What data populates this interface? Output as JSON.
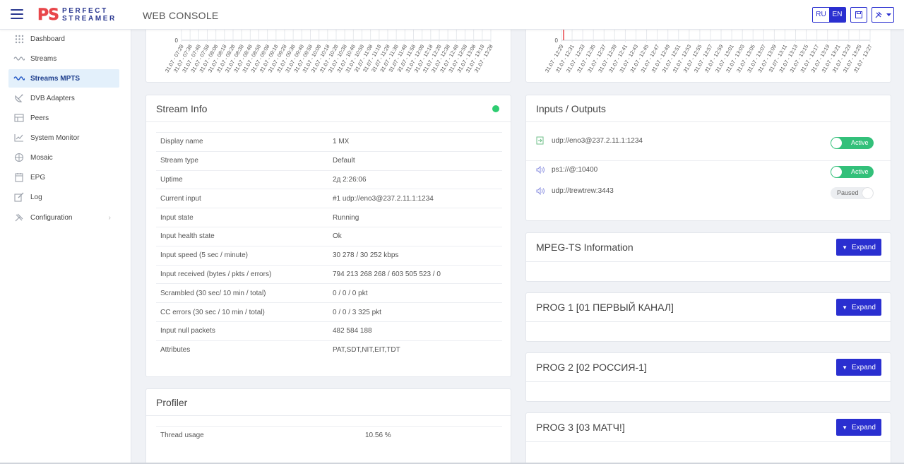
{
  "brand": {
    "ps": "PS",
    "line1": "PERFECT",
    "line2": "STREAMER"
  },
  "header": {
    "title": "WEB CONSOLE",
    "lang_ru": "RU",
    "lang_en": "EN"
  },
  "colors": {
    "accent": "#2a2fd0",
    "brand_red": "#e8464a",
    "brand_blue": "#2a3890",
    "active_green": "#33c07a",
    "chart_marker": "#e8464a"
  },
  "sidebar": {
    "items": [
      {
        "label": "Dashboard",
        "icon": "dashboard-grid-icon"
      },
      {
        "label": "Streams",
        "icon": "streams-wave-icon"
      },
      {
        "label": "Streams MPTS",
        "icon": "mpts-wave-icon"
      },
      {
        "label": "DVB Adapters",
        "icon": "satellite-dish-icon"
      },
      {
        "label": "Peers",
        "icon": "peers-icon"
      },
      {
        "label": "System Monitor",
        "icon": "chart-monitor-icon"
      },
      {
        "label": "Mosaic",
        "icon": "mosaic-icon"
      },
      {
        "label": "EPG",
        "icon": "epg-calendar-icon"
      },
      {
        "label": "Log",
        "icon": "log-edit-icon"
      },
      {
        "label": "Configuration",
        "icon": "tools-icon"
      }
    ]
  },
  "chart_left": {
    "y_zero": "0",
    "ticks": [
      "31.07 - 07:28",
      "31.07 - 07:38",
      "31.07 - 07:48",
      "31.07 - 07:58",
      "31.07 - 08:08",
      "31.07 - 08:18",
      "31.07 - 08:28",
      "31.07 - 08:38",
      "31.07 - 08:48",
      "31.07 - 08:58",
      "31.07 - 09:08",
      "31.07 - 09:18",
      "31.07 - 09:28",
      "31.07 - 09:38",
      "31.07 - 09:48",
      "31.07 - 09:58",
      "31.07 - 10:08",
      "31.07 - 10:18",
      "31.07 - 10:28",
      "31.07 - 10:38",
      "31.07 - 10:48",
      "31.07 - 10:58",
      "31.07 - 11:08",
      "31.07 - 11:18",
      "31.07 - 11:28",
      "31.07 - 11:38",
      "31.07 - 11:48",
      "31.07 - 11:58",
      "31.07 - 12:08",
      "31.07 - 12:18",
      "31.07 - 12:28",
      "31.07 - 12:38",
      "31.07 - 12:48",
      "31.07 - 12:58",
      "31.07 - 13:08",
      "31.07 - 13:18",
      "31.07 - 13:28"
    ]
  },
  "chart_right": {
    "y_zero": "0",
    "ticks": [
      "31.07 - 12:29",
      "31.07 - 12:31",
      "31.07 - 12:33",
      "31.07 - 12:35",
      "31.07 - 12:37",
      "31.07 - 12:39",
      "31.07 - 12:41",
      "31.07 - 12:43",
      "31.07 - 12:45",
      "31.07 - 12:47",
      "31.07 - 12:49",
      "31.07 - 12:51",
      "31.07 - 12:53",
      "31.07 - 12:55",
      "31.07 - 12:57",
      "31.07 - 12:59",
      "31.07 - 13:01",
      "31.07 - 13:03",
      "31.07 - 13:05",
      "31.07 - 13:07",
      "31.07 - 13:09",
      "31.07 - 13:11",
      "31.07 - 13:13",
      "31.07 - 13:15",
      "31.07 - 13:17",
      "31.07 - 13:19",
      "31.07 - 13:21",
      "31.07 - 13:23",
      "31.07 - 13:25",
      "31.07 - 13:27"
    ]
  },
  "stream_info": {
    "title": "Stream Info",
    "rows": [
      {
        "k": "Display name",
        "v": "1 MX"
      },
      {
        "k": "Stream type",
        "v": "Default"
      },
      {
        "k": "Uptime",
        "v": "2д 2:26:06"
      },
      {
        "k": "Current input",
        "v": "#1 udp://eno3@237.2.11.1:1234"
      },
      {
        "k": "Input state",
        "v": "Running"
      },
      {
        "k": "Input health state",
        "v": "Ok"
      },
      {
        "k": "Input speed (5 sec / minute)",
        "v": "30 278 / 30 252 kbps"
      },
      {
        "k": "Input received (bytes / pkts / errors)",
        "v": "794 213 268 268 / 603 505 523 / 0"
      },
      {
        "k": "Scrambled (30 sec/ 10 min / total)",
        "v": "0 / 0 / 0 pkt"
      },
      {
        "k": "CC errors (30 sec / 10 min / total)",
        "v": "0 / 0 / 3 325 pkt"
      },
      {
        "k": "Input null packets",
        "v": "482 584 188"
      },
      {
        "k": "Attributes",
        "v": "PAT,SDT,NIT,EIT,TDT"
      }
    ]
  },
  "profiler": {
    "title": "Profiler",
    "rows": [
      {
        "k": "Thread usage",
        "v": "10.56 %"
      }
    ]
  },
  "io": {
    "title": "Inputs / Outputs",
    "input": {
      "url": "udp://eno3@237.2.11.1:1234",
      "state": "Active"
    },
    "outputs": [
      {
        "url": "ps1://@:10400",
        "state": "Active"
      },
      {
        "url": "udp://trewtrew:3443",
        "state": "Paused"
      }
    ]
  },
  "panels": [
    {
      "title": "MPEG-TS Information",
      "button": "Expand"
    },
    {
      "title": "PROG 1 [01 ПЕРВЫЙ КАНАЛ]",
      "button": "Expand"
    },
    {
      "title": "PROG 2 [02 РОССИЯ-1]",
      "button": "Expand"
    },
    {
      "title": "PROG 3 [03 МАТЧ!]",
      "button": "Expand"
    }
  ]
}
